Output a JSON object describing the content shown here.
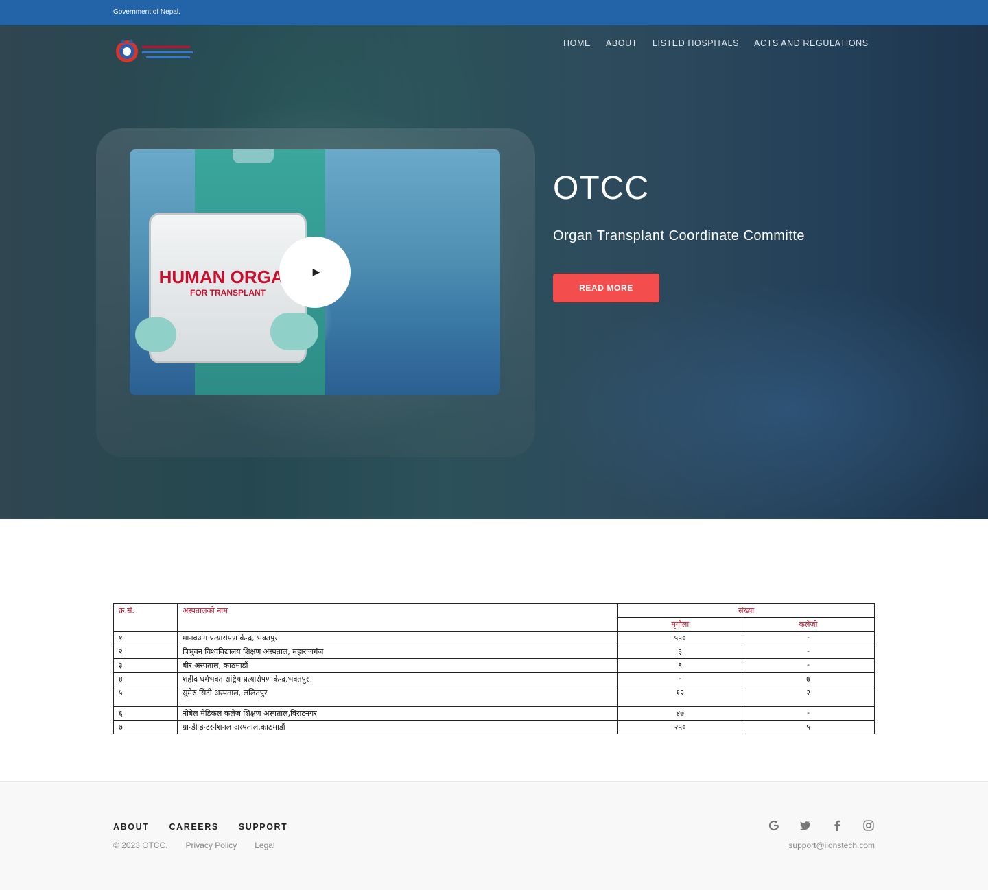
{
  "topbar": {
    "text": "Government of Nepal."
  },
  "nav": {
    "items": [
      {
        "label": "HOME"
      },
      {
        "label": "ABOUT"
      },
      {
        "label": "LISTED HOSPITALS"
      },
      {
        "label": "ACTS AND REGULATIONS"
      }
    ]
  },
  "hero": {
    "title": "OTCC",
    "subtitle": "Organ Transplant Coordinate Committe",
    "button": "READ MORE",
    "video_caption_line1": "HUMAN ORGAN",
    "video_caption_line2": "FOR TRANSPLANT",
    "play_icon": "play-icon"
  },
  "table": {
    "headers": {
      "sn": "क्र.सं.",
      "hospital": "अस्पतालको नाम",
      "group": "संख्या",
      "sub1": "मृगौला",
      "sub2": "कलेजो"
    },
    "rows": [
      {
        "sn": "१",
        "name": "मानवअंग प्रत्यारोपण केन्द्र, भक्तपुर",
        "v1": "५५०",
        "v2": "-"
      },
      {
        "sn": "२",
        "name": "त्रिभुवन विश्वविद्यालय शिक्षण अस्पताल, महाराजगंज",
        "v1": "३",
        "v2": "-"
      },
      {
        "sn": "३",
        "name": "बीर अस्पताल, काठमाडौं",
        "v1": "९",
        "v2": "-"
      },
      {
        "sn": "४",
        "name": "शहीद धर्मभक्त राष्ट्रिय प्रत्यारोपण केन्द्र,भक्तपुर",
        "v1": "-",
        "v2": "७"
      },
      {
        "sn": "५",
        "name": "सुमेरु सिटी अस्पताल, ललितपुर",
        "v1": "१२",
        "v2": "२"
      },
      {
        "sn": "६",
        "name": "नोबेल मेडिकल कलेज शिक्षण अस्पताल,विराटनगर",
        "v1": "४७",
        "v2": "-"
      },
      {
        "sn": "७",
        "name": "ग्रान्डी इन्टरनेशनल अस्पताल,काठमाडौं",
        "v1": "२५०",
        "v2": "५"
      }
    ]
  },
  "footer": {
    "links": [
      {
        "label": "ABOUT"
      },
      {
        "label": "CAREERS"
      },
      {
        "label": "SUPPORT"
      }
    ],
    "copyright": "© 2023 OTCC.",
    "privacy": "Privacy Policy",
    "legal": "Legal",
    "email": "support@iionstech.com",
    "social": [
      "google-icon",
      "twitter-icon",
      "facebook-icon",
      "instagram-icon"
    ]
  }
}
